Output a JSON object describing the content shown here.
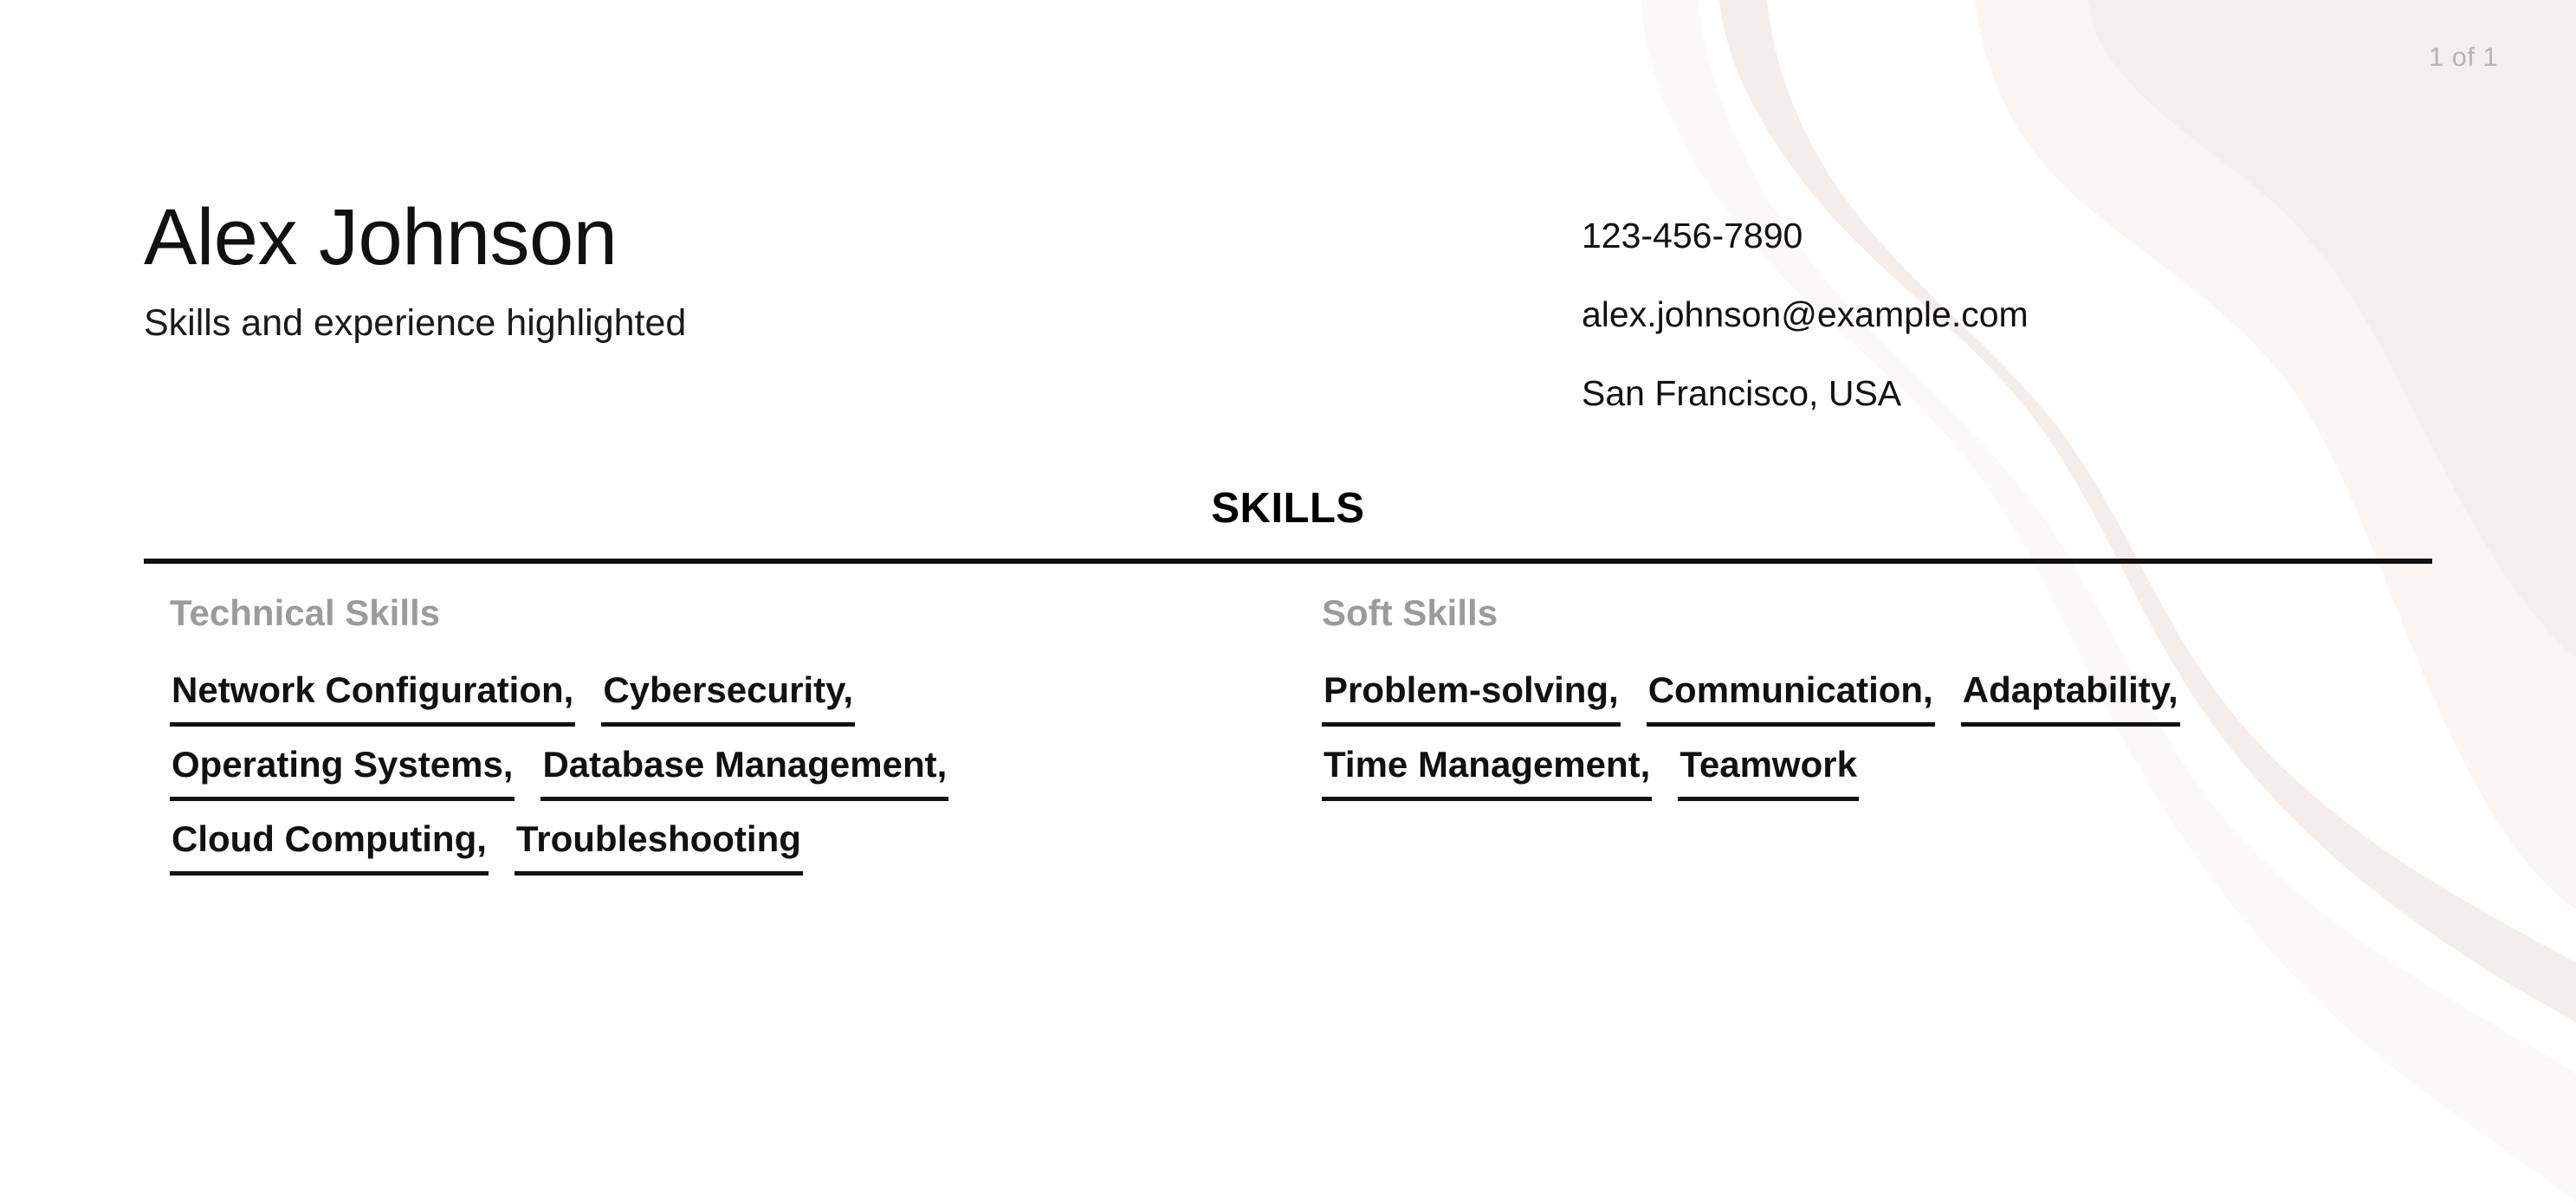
{
  "document": {
    "page_indicator": "1 of 1"
  },
  "header": {
    "full_name": "Alex Johnson",
    "tagline": "Skills and experience highlighted",
    "contact": [
      "123-456-7890",
      "alex.johnson@example.com",
      "San Francisco, USA"
    ]
  },
  "section": {
    "title": "SKILLS",
    "columns": [
      {
        "heading": "Technical Skills",
        "rows": [
          [
            "Network Configuration,",
            "Cybersecurity,"
          ],
          [
            "Operating Systems,",
            "Database Management,"
          ],
          [
            "Cloud Computing,",
            "Troubleshooting"
          ]
        ]
      },
      {
        "heading": "Soft Skills",
        "rows": [
          [
            "Problem-solving,",
            "Communication,",
            "Adaptability,"
          ],
          [
            "Time Management,",
            "Teamwork"
          ]
        ]
      }
    ]
  },
  "theme": {
    "page_background": "#ffffff",
    "blob_fill": "#f6f2ef",
    "blob_fill_soft": "#faf7f5",
    "text_primary": "#111111",
    "muted_heading": "#9b9b9b",
    "page_indicator_color": "#b9b3ae",
    "rule_color": "#111111"
  }
}
